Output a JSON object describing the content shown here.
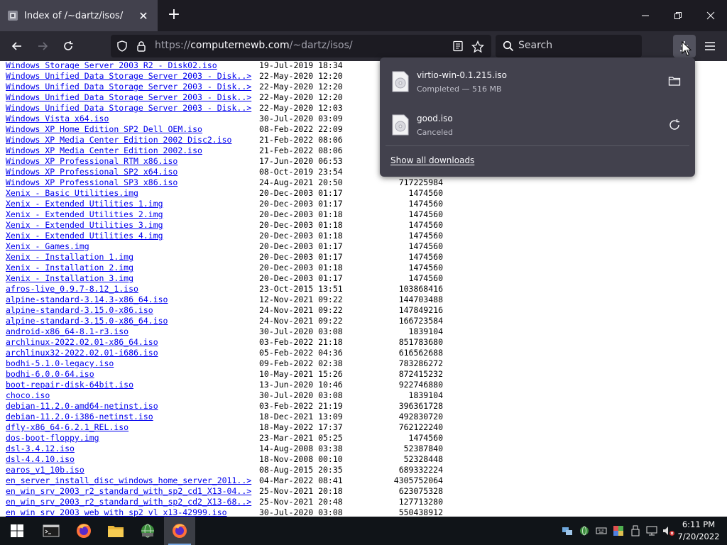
{
  "tab": {
    "title": "Index of /~dartz/isos/"
  },
  "urlbar": {
    "scheme": "https://",
    "host": "computernewb.com",
    "path": "/~dartz/isos/"
  },
  "search": {
    "placeholder": "Search"
  },
  "downloads": {
    "items": [
      {
        "name": "virtio-win-0.1.215.iso",
        "status": "Completed — 516 MB",
        "action_icon": "folder-icon"
      },
      {
        "name": "good.iso",
        "status": "Canceled",
        "action_icon": "retry-icon"
      }
    ],
    "show_all": "Show all downloads"
  },
  "listing": [
    {
      "name": "Windows Storage Server 2003 R2 - Disk02.iso",
      "date": "19-Jul-2019 18:34",
      "size": ""
    },
    {
      "name": "Windows Unified Data Storage Server 2003 - Disk..>",
      "date": "22-May-2020 12:20",
      "size": ""
    },
    {
      "name": "Windows Unified Data Storage Server 2003 - Disk..>",
      "date": "22-May-2020 12:20",
      "size": ""
    },
    {
      "name": "Windows Unified Data Storage Server 2003 - Disk..>",
      "date": "22-May-2020 12:20",
      "size": ""
    },
    {
      "name": "Windows Unified Data Storage Server 2003 - Disk..>",
      "date": "22-May-2020 12:03",
      "size": ""
    },
    {
      "name": "Windows Vista x64.iso",
      "date": "30-Jul-2020 03:09",
      "size": ""
    },
    {
      "name": "Windows XP Home Edition SP2 Dell OEM.iso",
      "date": "08-Feb-2022 22:09",
      "size": ""
    },
    {
      "name": "Windows XP Media Center Edition 2002 Disc2.iso",
      "date": "21-Feb-2022 08:06",
      "size": ""
    },
    {
      "name": "Windows XP Media Center Edition 2002.iso",
      "date": "21-Feb-2022 08:06",
      "size": ""
    },
    {
      "name": "Windows XP Professional RTM x86.iso",
      "date": "17-Jun-2020 06:53",
      "size": ""
    },
    {
      "name": "Windows XP Professional SP2 x64.iso",
      "date": "08-Oct-2019 23:54",
      "size": ""
    },
    {
      "name": "Windows XP Professional SP3 x86.iso",
      "date": "24-Aug-2021 20:50",
      "size": "717225984"
    },
    {
      "name": "Xenix - Basic Utilities.img",
      "date": "20-Dec-2003 01:17",
      "size": "1474560"
    },
    {
      "name": "Xenix - Extended Utilities 1.img",
      "date": "20-Dec-2003 01:17",
      "size": "1474560"
    },
    {
      "name": "Xenix - Extended Utilities 2.img",
      "date": "20-Dec-2003 01:18",
      "size": "1474560"
    },
    {
      "name": "Xenix - Extended Utilities 3.img",
      "date": "20-Dec-2003 01:18",
      "size": "1474560"
    },
    {
      "name": "Xenix - Extended Utilities 4.img",
      "date": "20-Dec-2003 01:18",
      "size": "1474560"
    },
    {
      "name": "Xenix - Games.img",
      "date": "20-Dec-2003 01:17",
      "size": "1474560"
    },
    {
      "name": "Xenix - Installation 1.img",
      "date": "20-Dec-2003 01:17",
      "size": "1474560"
    },
    {
      "name": "Xenix - Installation 2.img",
      "date": "20-Dec-2003 01:18",
      "size": "1474560"
    },
    {
      "name": "Xenix - Installation 3.img",
      "date": "20-Dec-2003 01:17",
      "size": "1474560"
    },
    {
      "name": "afros-live_0.9.7-8.12_1.iso",
      "date": "23-Oct-2015 13:51",
      "size": "103868416"
    },
    {
      "name": "alpine-standard-3.14.3-x86_64.iso",
      "date": "12-Nov-2021 09:22",
      "size": "144703488"
    },
    {
      "name": "alpine-standard-3.15.0-x86.iso",
      "date": "24-Nov-2021 09:22",
      "size": "147849216"
    },
    {
      "name": "alpine-standard-3.15.0-x86_64.iso",
      "date": "24-Nov-2021 09:22",
      "size": "166723584"
    },
    {
      "name": "android-x86_64-8.1-r3.iso",
      "date": "30-Jul-2020 03:08",
      "size": "1839104"
    },
    {
      "name": "archlinux-2022.02.01-x86_64.iso",
      "date": "03-Feb-2022 21:18",
      "size": "851783680"
    },
    {
      "name": "archlinux32-2022.02.01-i686.iso",
      "date": "05-Feb-2022 04:36",
      "size": "616562688"
    },
    {
      "name": "bodhi-5.1.0-legacy.iso",
      "date": "09-Feb-2022 02:38",
      "size": "783286272"
    },
    {
      "name": "bodhi-6.0.0-64.iso",
      "date": "10-May-2021 15:26",
      "size": "872415232"
    },
    {
      "name": "boot-repair-disk-64bit.iso",
      "date": "13-Jun-2020 10:46",
      "size": "922746880"
    },
    {
      "name": "choco.iso",
      "date": "30-Jul-2020 03:08",
      "size": "1839104"
    },
    {
      "name": "debian-11.2.0-amd64-netinst.iso",
      "date": "03-Feb-2022 21:19",
      "size": "396361728"
    },
    {
      "name": "debian-11.2.0-i386-netinst.iso",
      "date": "18-Dec-2021 13:09",
      "size": "492830720"
    },
    {
      "name": "dfly-x86_64-6.2.1_REL.iso",
      "date": "18-May-2022 17:37",
      "size": "762122240"
    },
    {
      "name": "dos-boot-floppy.img",
      "date": "23-Mar-2021 05:25",
      "size": "1474560"
    },
    {
      "name": "dsl-3.4.12.iso",
      "date": "14-Aug-2008 03:38",
      "size": "52387840"
    },
    {
      "name": "dsl-4.4.10.iso",
      "date": "18-Nov-2008 00:10",
      "size": "52328448"
    },
    {
      "name": "earos_v1_10b.iso",
      "date": "08-Aug-2015 20:35",
      "size": "689332224"
    },
    {
      "name": "en_server_install_disc_windows_home_server_2011..>",
      "date": "04-Mar-2022 08:41",
      "size": "4305752064"
    },
    {
      "name": "en_win_srv_2003_r2_standard_with_sp2_cd1_X13-04..>",
      "date": "25-Nov-2021 20:18",
      "size": "623075328"
    },
    {
      "name": "en_win_srv_2003_r2_standard_with_sp2_cd2_X13-68..>",
      "date": "25-Nov-2021 20:48",
      "size": "127713280"
    },
    {
      "name": "en_win_srv_2003_web_with_sp2_vl_x13-42999.iso",
      "date": "30-Jul-2020 03:08",
      "size": "550438912"
    }
  ],
  "taskbar": {
    "apps": [
      "terminal-app",
      "firefox-app",
      "file-explorer-app",
      "network-app",
      "firefox-active-app"
    ],
    "time": "6:11 PM",
    "date": "7/20/2022"
  },
  "colors": {
    "link": "#0000ee",
    "tabbar": "#1c1b22",
    "toolbar": "#2b2a33",
    "panel": "#42414d",
    "taskbar": "#101418"
  }
}
